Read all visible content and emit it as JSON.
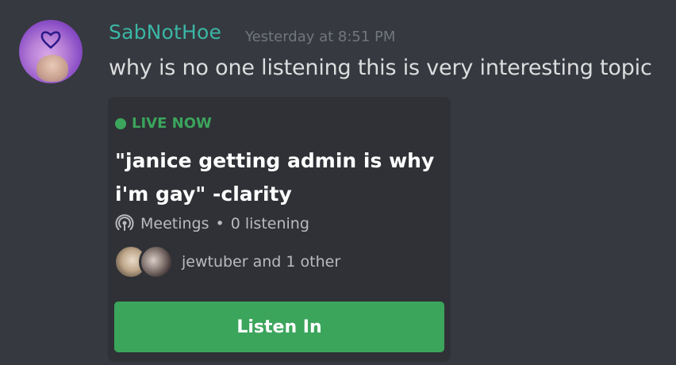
{
  "message": {
    "username": "SabNotHoe",
    "timestamp": "Yesterday at 8:51 PM",
    "text": "why is no one listening this is very interesting topic",
    "username_color": "#3bb6a5"
  },
  "stage_card": {
    "live_label": "LIVE NOW",
    "topic_line1": "\"janice getting admin is why",
    "topic_line2": "i'm gay\" -clarity",
    "channel_icon": "stage-icon",
    "channel_name": "Meetings",
    "separator": "•",
    "listening": "0 listening",
    "speakers_text": "jewtuber and 1 other",
    "button_label": "Listen In",
    "accent_color": "#3ba55c"
  }
}
